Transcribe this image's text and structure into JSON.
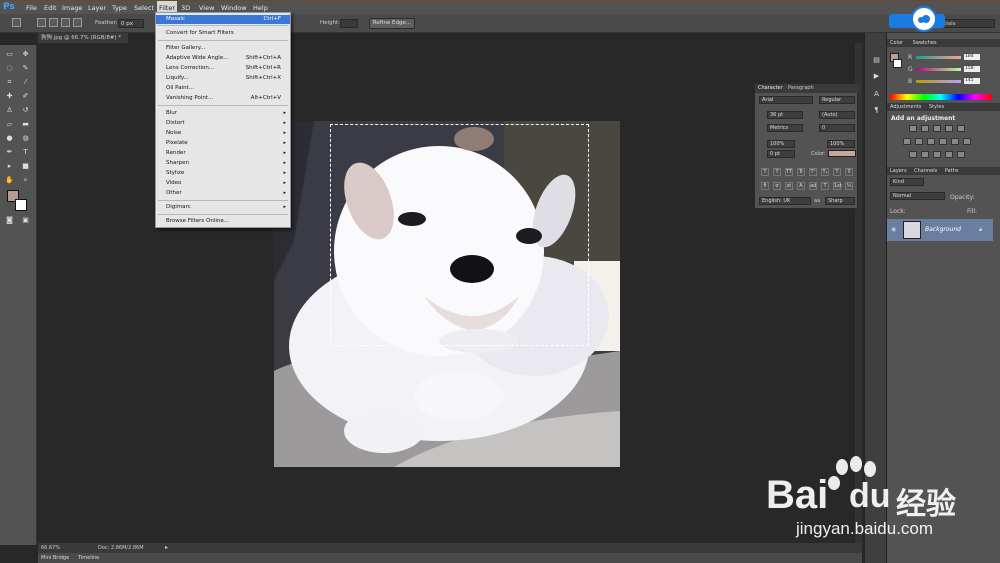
{
  "app": {
    "logo": "Ps",
    "doc_tab": "狗狗.jpg @ 66.7% (RGB/8#) *"
  },
  "menubar": [
    "File",
    "Edit",
    "Image",
    "Layer",
    "Type",
    "Select",
    "Filter",
    "3D",
    "View",
    "Window",
    "Help"
  ],
  "options": {
    "feather_label": "Feather:",
    "feather_value": "0 px",
    "height_label": "Height:",
    "refine_label": "Refine Edge..."
  },
  "filter_menu": {
    "items": [
      {
        "label": "Mosaic",
        "shortcut": "Ctrl+F"
      },
      {
        "label": "Convert for Smart Filters",
        "shortcut": ""
      },
      {
        "label": "Filter Gallery...",
        "shortcut": ""
      },
      {
        "label": "Adaptive Wide Angle...",
        "shortcut": "Shift+Ctrl+A"
      },
      {
        "label": "Lens Correction...",
        "shortcut": "Shift+Ctrl+R"
      },
      {
        "label": "Liquify...",
        "shortcut": "Shift+Ctrl+X"
      },
      {
        "label": "Oil Paint...",
        "shortcut": ""
      },
      {
        "label": "Vanishing Point...",
        "shortcut": "Alt+Ctrl+V"
      },
      {
        "label": "Blur",
        "submenu": true
      },
      {
        "label": "Distort",
        "submenu": true
      },
      {
        "label": "Noise",
        "submenu": true
      },
      {
        "label": "Pixelate",
        "submenu": true
      },
      {
        "label": "Render",
        "submenu": true
      },
      {
        "label": "Sharpen",
        "submenu": true
      },
      {
        "label": "Stylize",
        "submenu": true
      },
      {
        "label": "Video",
        "submenu": true
      },
      {
        "label": "Other",
        "submenu": true
      },
      {
        "label": "Digimarc",
        "submenu": true
      },
      {
        "label": "Browse Filters Online...",
        "shortcut": ""
      }
    ]
  },
  "status": {
    "zoom": "66.67%",
    "doc": "Doc: 2.86M/2.86M"
  },
  "bottom_tabs": [
    "Mini Bridge",
    "Timeline"
  ],
  "color_panel": {
    "tabs": [
      "Color",
      "Swatches"
    ],
    "r": "184",
    "g": "158",
    "b": "145",
    "r_lbl": "R",
    "g_lbl": "G",
    "b_lbl": "B",
    "fg": "#b89e91"
  },
  "adjustments_panel": {
    "tabs": [
      "Adjustments",
      "Styles"
    ],
    "title": "Add an adjustment"
  },
  "layers_panel": {
    "tabs": [
      "Layers",
      "Channels",
      "Paths"
    ],
    "kind": "Kind",
    "blend": "Normal",
    "opacity_lbl": "Opacity:",
    "lock_lbl": "Lock:",
    "fill_lbl": "Fill:",
    "layer_name": "Background"
  },
  "character_panel": {
    "tabs": [
      "Character",
      "Paragraph"
    ],
    "font": "Arial",
    "style": "Regular",
    "size": "36 pt",
    "leading": "(Auto)",
    "kerning": "Metrics",
    "tracking": "0",
    "vscale": "100%",
    "hscale": "100%",
    "baseline": "0 pt",
    "color_lbl": "Color:",
    "language": "English: UK",
    "aa_lbl": "aa",
    "aa": "Sharp",
    "text_buttons": [
      "T",
      "T",
      "TT",
      "Tr",
      "T¹",
      "T₁",
      "T",
      "Ŧ"
    ],
    "lig_buttons": [
      "fi",
      "σ",
      "st",
      "A",
      "ad",
      "T",
      "1st",
      "½"
    ],
    "color_value": "#c9a59a"
  },
  "workspace": "Essentials",
  "upload_button": "拖拽上传",
  "watermark": {
    "brand": "Bai",
    "du": "du",
    "cn": "经验",
    "url": "jingyan.baidu.com"
  }
}
